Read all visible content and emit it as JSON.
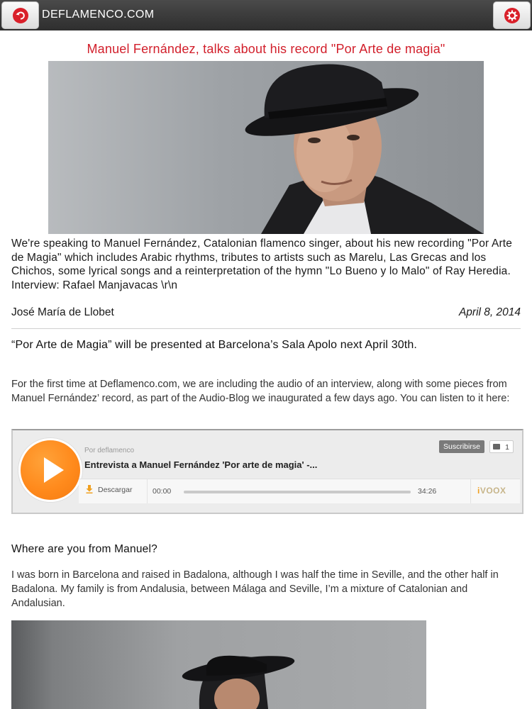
{
  "header": {
    "site_name": "DEFLAMENCO.COM",
    "back_icon": "back-arrow-icon",
    "settings_icon": "gear-icon",
    "accent": "#d21f2b"
  },
  "article": {
    "headline": "Manuel Fernández, talks about his record \"Por Arte de magia\"",
    "intro": "We're speaking to Manuel Fernández, Catalonian flamenco singer, about his new recording \"Por Arte de Magia\" which includes Arabic rhythms, tributes to artists such as Marelu, Las Grecas and los Chichos, some lyrical songs and a reinterpretation of the hymn \"Lo Bueno y lo Malo\" of Ray Heredia.",
    "interview_credit": "Interview: Rafael Manjavacas \\r\\n",
    "author": "José María de Llobet",
    "date": "April 8, 2014",
    "lead": "“Por Arte de Magia” will be presented at Barcelona’s Sala Apolo next April 30th.",
    "paragraph1": "For the first time at Deflamenco.com, we are including the audio of an interview, along with some pieces from Manuel Fernández’ record, as part of the Audio-Blog we inaugurated a few days ago.  You can listen to it here:",
    "question1": "Where are you from Manuel?",
    "answer1": "I was born in Barcelona and raised in Badalona, although I was half the time in Seville, and the other half in Badalona.  My family is from Andalusia, between Málaga and Seville, I’m a mixture of Catalonian and Andalusian."
  },
  "player": {
    "channel": "Por deflamenco",
    "title": "Entrevista a Manuel Fernández 'Por arte de magia' -...",
    "subscribe_label": "Suscribirse",
    "likes": "1",
    "download_label": "Descargar",
    "time_start": "00:00",
    "time_end": "34:26",
    "brand_logo_prefix": "i",
    "brand_logo_rest": "VOOX",
    "progress_fraction": 0,
    "play_color": "#ff8a1c"
  }
}
